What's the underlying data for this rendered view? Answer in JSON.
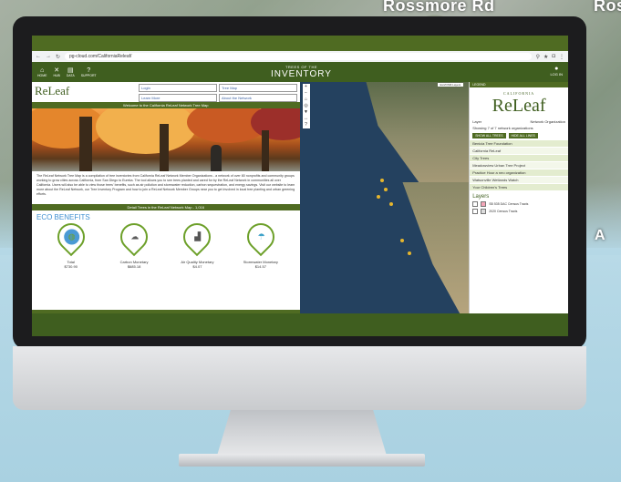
{
  "street_labels": {
    "left": "Rossmore Rd",
    "right": "Ros",
    "bottom_right": "A"
  },
  "browser": {
    "url": "pg-cloud.com/CaliforniaReleaf/",
    "nav_icons": [
      "back-icon",
      "forward-icon",
      "reload-icon"
    ]
  },
  "appbar": {
    "nav": [
      {
        "label": "HOME",
        "icon": "home-icon"
      },
      {
        "label": "HUB",
        "icon": "hub-icon"
      },
      {
        "label": "DATA",
        "icon": "data-icon"
      },
      {
        "label": "SUPPORT",
        "icon": "support-icon"
      }
    ],
    "brand_top": "TREES OF THE",
    "brand_main": "INVENTORY",
    "login": "LOG IN"
  },
  "left": {
    "logo": "ReLeaf",
    "links": [
      "Login",
      "Tree Map",
      "Learn More",
      "About the Network"
    ],
    "welcome": "Welcome to the California ReLeaf Network Tree Map",
    "description": "The ReLeaf Network Tree Map is a compilation of tree inventories from California ReLeaf Network Member Organizations - a network of over 80 nonprofits and community groups working to grow cities across California, from San Diego to Eureka. The tool allows you to see trees planted and cared for by the ReLeaf Network in communities all over California. Users will also be able to view those trees' benefits, such as air pollution and stormwater reduction, carbon sequestration, and energy savings. Visit our website to learn more about the ReLeaf Network, our Tree Inventory Program and how to join a ReLeaf Network Member Groups near you to get involved in local tree planting and urban greening efforts.",
    "detail_button": "Detail Trees in the ReLeaf Network Map - 1,016",
    "eco_title": "ECO BENEFITS",
    "eco_items": [
      {
        "label": "Total",
        "value": "$730.90",
        "icon": "globe-icon",
        "color": "#4a9ad4"
      },
      {
        "label": "Carbon Monetary",
        "value": "$685.18",
        "icon": "co2-cloud-icon",
        "color": "#5a5a5a"
      },
      {
        "label": "Air Quality Monetary",
        "value": "$4.07",
        "icon": "factory-icon",
        "color": "#555555"
      },
      {
        "label": "Stormwater Monetary",
        "value": "$14.57",
        "icon": "rain-icon",
        "color": "#3aa0c8"
      }
    ]
  },
  "map": {
    "legend": "Esri/OSM Layers"
  },
  "right": {
    "header": "LEGEND",
    "logo_top": "CALIFORNIA",
    "logo_main": "ReLeaf",
    "layer_label": "Layer",
    "layer_value": "Network Organization",
    "showing": "Showing 7 of 7 network organizations",
    "btn_show_all": "SHOW ALL TREES",
    "btn_hide_all": "HIDE ALL LINES",
    "orgs": [
      "Benicia Tree Foundation",
      "California ReLeaf",
      "City Trees",
      "Meadowview Urban Tree Project",
      "Practice Hour a neo organization",
      "Watsonville Wetlands Watch",
      "Your Children's Trees"
    ],
    "layers_title": "Layers",
    "layers": [
      "SB 535 DAC Census Tracts",
      "2020 Census Tracts"
    ]
  },
  "colors": {
    "accent": "#4f6b22",
    "dark": "#3f5e1f",
    "eco_title": "#3f8fd1"
  }
}
